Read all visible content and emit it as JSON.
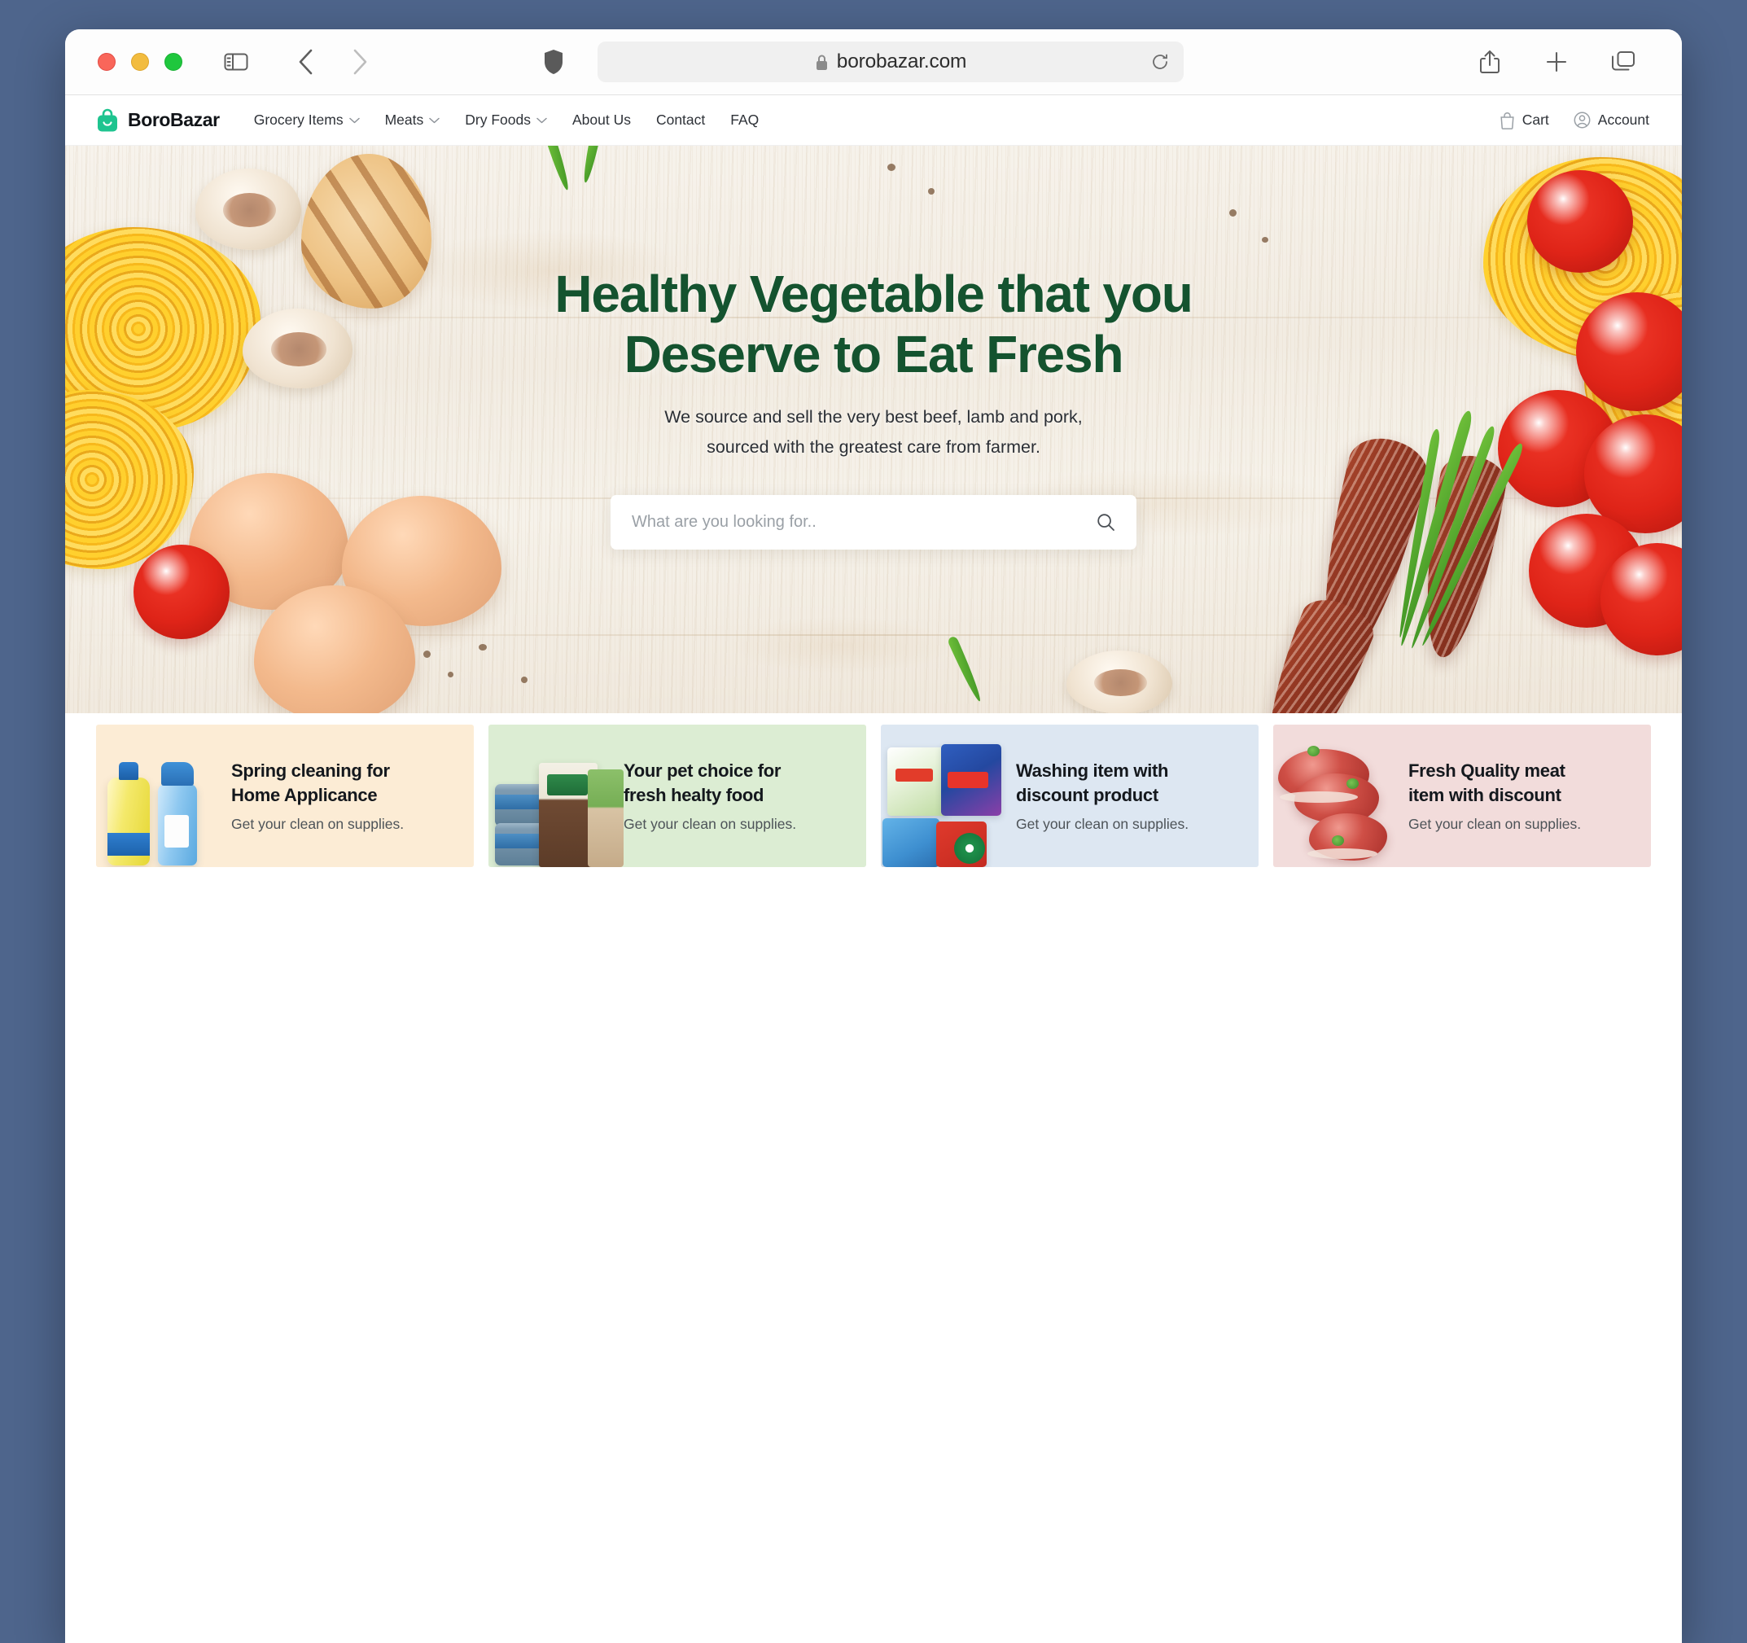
{
  "browser": {
    "traffic_lights": [
      "close",
      "minimize",
      "maximize"
    ],
    "url": "borobazar.com",
    "lock_icon": "lock-icon",
    "shield_icon": "shield-icon",
    "sidebar_icon": "sidebar-toggle-icon",
    "back_icon": "chevron-left-icon",
    "forward_icon": "chevron-right-icon",
    "reload_icon": "reload-icon",
    "share_icon": "share-icon",
    "new_tab_icon": "plus-icon",
    "tabs_icon": "tab-overview-icon"
  },
  "site_header": {
    "brand": "BoroBazar",
    "brand_icon": "shopping-bag-logo-icon",
    "brand_color": "#1ec48f",
    "nav": [
      {
        "label": "Grocery Items",
        "has_caret": true
      },
      {
        "label": "Meats",
        "has_caret": true
      },
      {
        "label": "Dry Foods",
        "has_caret": true
      },
      {
        "label": "About Us",
        "has_caret": false
      },
      {
        "label": "Contact",
        "has_caret": false
      },
      {
        "label": "FAQ",
        "has_caret": false
      }
    ],
    "actions": [
      {
        "label": "Cart",
        "icon": "cart-bag-icon"
      },
      {
        "label": "Account",
        "icon": "user-circle-icon"
      }
    ]
  },
  "hero": {
    "title_line1": "Healthy Vegetable that you",
    "title_line2": "Deserve to Eat Fresh",
    "title_color": "#14532f",
    "subtitle_line1": "We source and sell the very best beef, lamb and pork,",
    "subtitle_line2": "sourced with the greatest care from farmer.",
    "search_placeholder": "What are you looking for..",
    "search_value": "",
    "search_icon": "search-icon"
  },
  "promos": [
    {
      "title_line1": "Spring cleaning for",
      "title_line2": "Home Applicance",
      "subtitle": "Get your clean on supplies.",
      "bg": "#fcecd5",
      "art": "cleaning-products"
    },
    {
      "title_line1": "Your pet choice for",
      "title_line2": "fresh healty food",
      "subtitle": "Get your clean on supplies.",
      "bg": "#dcedd3",
      "art": "pet-food-products"
    },
    {
      "title_line1": "Washing item with",
      "title_line2": "discount product",
      "subtitle": "Get your clean on supplies.",
      "bg": "#dde7f2",
      "art": "detergent-products"
    },
    {
      "title_line1": "Fresh Quality meat",
      "title_line2": "item with discount",
      "subtitle": "Get your clean on supplies.",
      "bg": "#f2dcdb",
      "art": "raw-meat-cuts"
    }
  ]
}
